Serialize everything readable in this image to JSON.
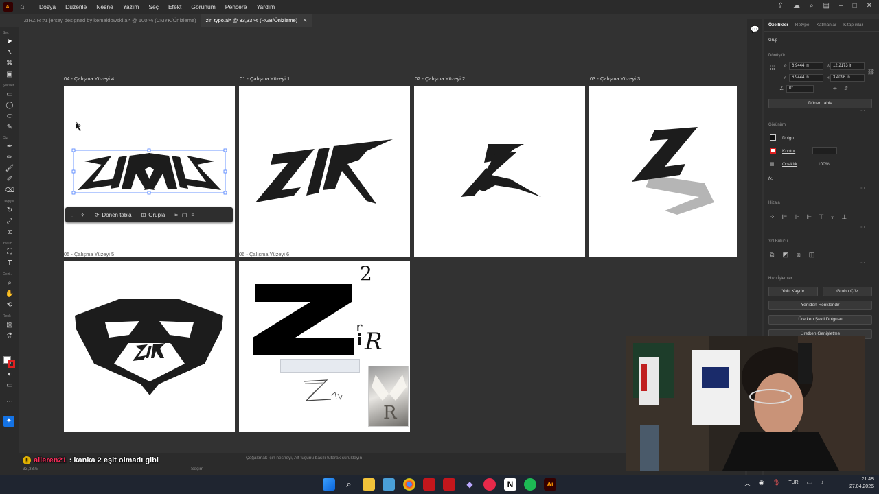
{
  "app": {
    "logo": "Ai",
    "menu": [
      "Dosya",
      "Düzenle",
      "Nesne",
      "Yazım",
      "Seç",
      "Efekt",
      "Görünüm",
      "Pencere",
      "Yardım"
    ]
  },
  "tabs": [
    {
      "label": "ZIRZIR #1 jersey designed by kemaldowski.ai* @ 100 % (CMYK/Önizleme)",
      "active": false
    },
    {
      "label": "zir_typo.ai* @ 33,33 % (RGB/Önizleme)",
      "active": true
    }
  ],
  "toolbar": {
    "groups": [
      "Seç",
      "Şekiller",
      "Çiz",
      "Değiştir",
      "Yazım",
      "Gezi...",
      "Renk"
    ]
  },
  "artboards": {
    "labels": [
      "04 - Çalışma Yüzeyi 4",
      "01 - Çalışma Yüzeyi 1",
      "02 - Çalışma Yüzeyi 2",
      "03 - Çalışma Yüzeyi 3",
      "05 - Çalışma Yüzeyi 5",
      "06 - Çalışma Yüzeyi 6"
    ]
  },
  "context_bar": {
    "rotate_label": "Dönen tabla",
    "group_label": "Grupla"
  },
  "properties": {
    "tabs": [
      "Özellikler",
      "Retype",
      "Katmanlar",
      "Kitaplıklar"
    ],
    "kind": "Grup",
    "transform_title": "Dönüştür",
    "x": "6,9444 in",
    "y": "6,9444 in",
    "w": "12,2173 in",
    "h": "3,4096 in",
    "angle": "0°",
    "rotate_button": "Dönen tabla",
    "appearance_title": "Görünüm",
    "fill_label": "Dolgu",
    "stroke_label": "Kontur",
    "opacity_label": "Opaklık",
    "opacity_value": "100%",
    "fx_label": "fx.",
    "align_title": "Hizala",
    "pathfinder_title": "Yol Bulucu",
    "quick_title": "Hızlı İşlemler",
    "quick_row": [
      "Yolu Kaydır",
      "Grubu Çöz"
    ],
    "quick_buttons": [
      "Yeniden Renklendir",
      "Üretken Şekil Dolgusu",
      "Üretken Genişletme"
    ]
  },
  "status": {
    "zoom": "33,33%",
    "hint": "Çoğaltmak için nesneyi, Alt tuşunu basılı tutarak sürükleyin",
    "mode": "Seçim"
  },
  "chat": {
    "user": "alieren21",
    "message": ": kanka 2 eşit olmadı gibi"
  },
  "taskbar": {
    "lang": "TUR",
    "time": "21:48",
    "date": "27.04.2026"
  },
  "artwork": {
    "zir": "ZIR",
    "two": "2",
    "z": "Z",
    "ir_r": "r",
    "ir_i": "i",
    "ir_R": "R"
  }
}
